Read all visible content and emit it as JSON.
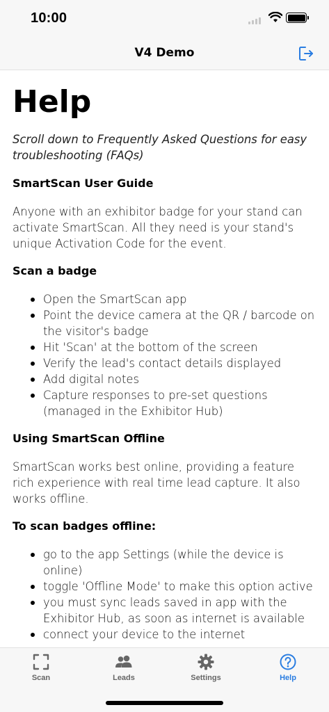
{
  "status": {
    "time": "10:00"
  },
  "nav": {
    "title": "V4 Demo",
    "logout_icon": "logout-icon"
  },
  "page": {
    "title": "Help",
    "intro": "Scroll down to Frequently Asked Questions for easy troubleshooting (FAQs)",
    "sections": [
      {
        "heading": "SmartScan User Guide",
        "paragraph": "Anyone with an exhibitor badge for your stand can activate SmartScan. All they need is your stand's unique Activation Code for the event."
      },
      {
        "heading": "Scan a badge",
        "bullets": [
          "Open the SmartScan app",
          "Point the device camera at the QR / barcode on the visitor's badge",
          "Hit 'Scan' at the bottom of the screen",
          "Verify the lead's contact details displayed",
          "Add digital notes",
          "Capture responses to pre-set questions (managed in the Exhibitor Hub)"
        ]
      },
      {
        "heading": "Using SmartScan Offline",
        "paragraph": "SmartScan works best online, providing a feature rich experience with real time lead capture. It also works offline."
      },
      {
        "heading": "To scan badges offline:",
        "bullets": [
          "go to the app Settings (while the device is online)",
          "toggle 'Offline Mode' to make this option active",
          "you must sync leads saved in app with the Exhibitor Hub, as soon as internet is available",
          "connect your device to the internet"
        ]
      }
    ]
  },
  "tabs": [
    {
      "label": "Scan",
      "icon": "scan-icon"
    },
    {
      "label": "Leads",
      "icon": "people-icon"
    },
    {
      "label": "Settings",
      "icon": "gear-icon"
    },
    {
      "label": "Help",
      "icon": "question-circle-icon",
      "active": true
    }
  ],
  "colors": {
    "accent": "#2a7de1",
    "tab_inactive": "#666666",
    "bar_bg": "#f7f7f7"
  }
}
